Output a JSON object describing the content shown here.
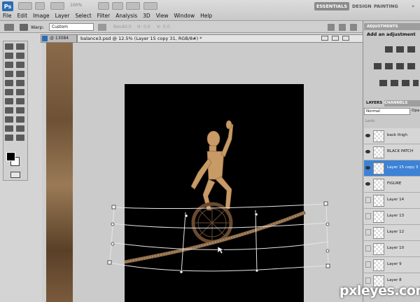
{
  "app": {
    "logo": "Ps",
    "zoom": "100%"
  },
  "menu": [
    "File",
    "Edit",
    "Image",
    "Layer",
    "Select",
    "Filter",
    "Analysis",
    "3D",
    "View",
    "Window",
    "Help"
  ],
  "workspaces": {
    "active": "ESSENTIALS",
    "design": "DESIGN",
    "painting": "PAINTING",
    "more": "»"
  },
  "options": {
    "warp_label": "Warp:",
    "warp_value": "Custom",
    "bend_label": "Bend:",
    "bend_value": "0.0",
    "h_label": "H:",
    "h_value": "0.0",
    "v_label": "V:",
    "v_value": "0.0"
  },
  "documents": {
    "tab_inactive": "@ 13084",
    "tab_active": "balance3.psd @ 12.5% (Layer 15 copy 31, RGB/8#) *"
  },
  "adjustments": {
    "panel_title": "ADJUSTMENTS",
    "heading": "Add an adjustment"
  },
  "layers_panel": {
    "tab_layers": "LAYERS",
    "tab_channels": "CHANNELS",
    "blend_mode": "Normal",
    "opacity_label": "Opa",
    "lock_label": "Lock:",
    "layers": [
      {
        "name": "back thigh",
        "visible": true,
        "selected": false
      },
      {
        "name": "BLACK PATCH",
        "visible": true,
        "selected": false
      },
      {
        "name": "Layer 15 copy 3",
        "visible": true,
        "selected": true
      },
      {
        "name": "FIGURE",
        "visible": true,
        "selected": false
      },
      {
        "name": "Layer 14",
        "visible": false,
        "selected": false
      },
      {
        "name": "Layer 13",
        "visible": false,
        "selected": false
      },
      {
        "name": "Layer 12",
        "visible": false,
        "selected": false
      },
      {
        "name": "Layer 10",
        "visible": false,
        "selected": false
      },
      {
        "name": "Layer 9",
        "visible": false,
        "selected": false
      },
      {
        "name": "Layer 8",
        "visible": false,
        "selected": false
      }
    ]
  },
  "watermark": "pxleyes.com"
}
